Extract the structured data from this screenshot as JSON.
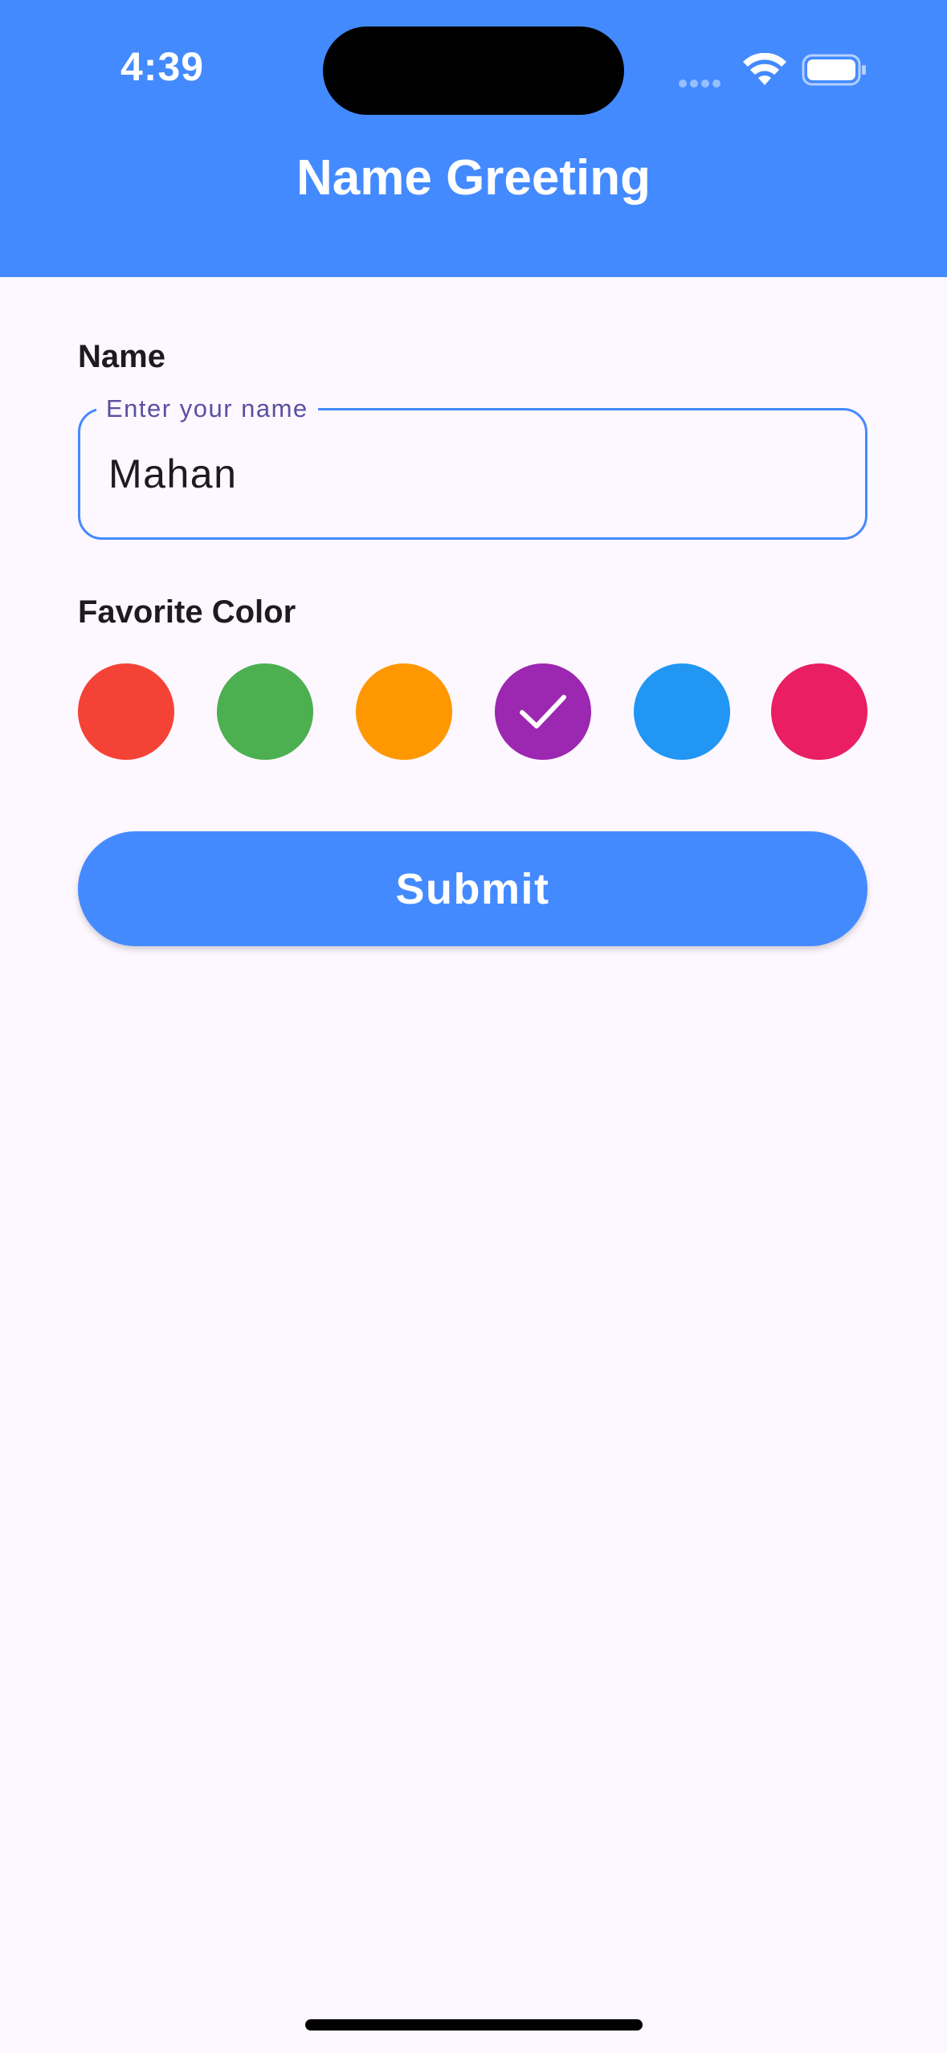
{
  "status_bar": {
    "time": "4:39"
  },
  "header": {
    "title": "Name Greeting",
    "background": "#448aff"
  },
  "form": {
    "name_section_label": "Name",
    "name_field": {
      "label": "Enter your name",
      "value": "Mahan"
    },
    "color_section_label": "Favorite Color",
    "colors": [
      {
        "name": "red",
        "hex": "#f44336",
        "selected": false
      },
      {
        "name": "green",
        "hex": "#4caf50",
        "selected": false
      },
      {
        "name": "orange",
        "hex": "#ff9800",
        "selected": false
      },
      {
        "name": "purple",
        "hex": "#9c27b0",
        "selected": true
      },
      {
        "name": "blue",
        "hex": "#2196f3",
        "selected": false
      },
      {
        "name": "pink",
        "hex": "#e91e63",
        "selected": false
      }
    ],
    "submit_label": "Submit"
  },
  "icons": {
    "selected_mark": "checkmark-icon",
    "status": [
      "signal-icon",
      "wifi-icon",
      "battery-icon"
    ]
  }
}
